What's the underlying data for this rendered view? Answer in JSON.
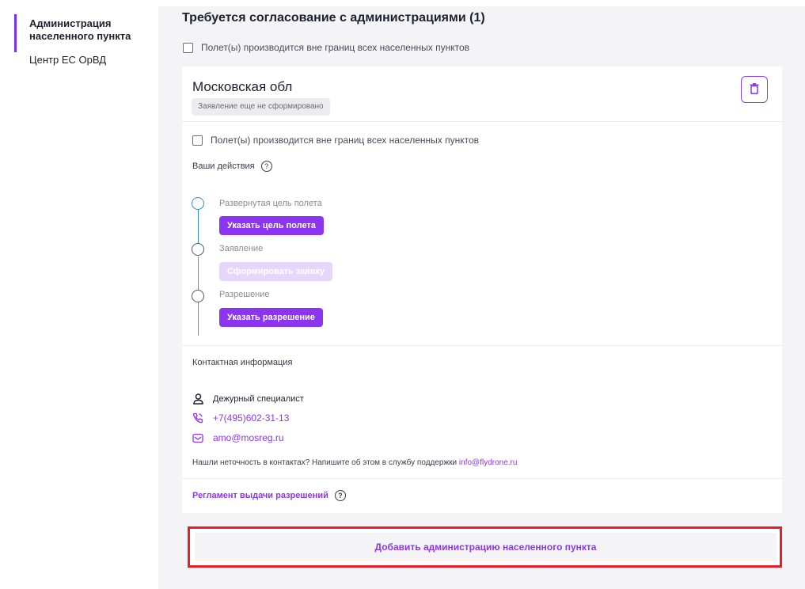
{
  "sidebar": {
    "items": [
      {
        "label": "Администрация населенного пункта"
      },
      {
        "label": "Центр ЕС ОрВД"
      }
    ]
  },
  "main": {
    "title": "Требуется согласование с администрациями (1)",
    "outside_checkbox_label": "Полет(ы) производится вне границ всех населенных пунктов"
  },
  "card": {
    "title": "Московская обл",
    "status": "Заявление еще не сформировано",
    "outside_checkbox_label": "Полет(ы) производится вне границ всех населенных пунктов",
    "actions_label": "Ваши действия",
    "help_glyph": "?",
    "steps": [
      {
        "label": "Развернутая цель полета",
        "button": "Указать цель полета",
        "enabled": true
      },
      {
        "label": "Заявление",
        "button": "Сформировать заявку",
        "enabled": false
      },
      {
        "label": "Разрешение",
        "button": "Указать разрешение",
        "enabled": true
      }
    ],
    "contact_label": "Контактная информация",
    "contact_person": "Дежурный специалист",
    "phone": "+7(495)602-31-13",
    "email": "amo@mosreg.ru",
    "support_note": "Нашли неточность в контактах? Напишите об этом в службу поддержки",
    "support_email": "info@flydrone.ru",
    "regulation_link": "Регламент выдачи разрешений"
  },
  "add_button_label": "Добавить администрацию населенного пункта",
  "colors": {
    "accent": "#8b35f0",
    "highlight_frame": "#e41e2a",
    "timeline_active": "#2f8fb5"
  }
}
